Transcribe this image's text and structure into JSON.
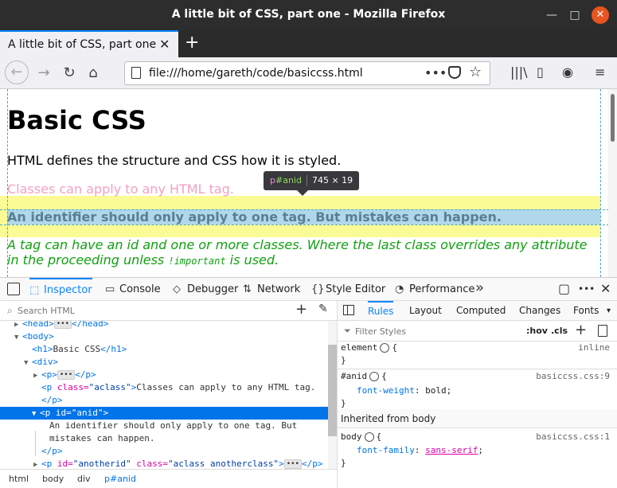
{
  "window": {
    "title": "A little bit of CSS, part one - Mozilla Firefox",
    "min_glyph": "—",
    "max_glyph": "□",
    "close_glyph": "✕"
  },
  "tab": {
    "label": "A little bit of CSS, part one",
    "close_glyph": "✕",
    "new_tab_glyph": "+"
  },
  "nav": {
    "back_glyph": "←",
    "forward_glyph": "→",
    "reload_glyph": "↻",
    "home_glyph": "⌂",
    "url": "file:///home/gareth/code/basiccss.html",
    "more_glyph": "•••",
    "star_glyph": "☆",
    "library_glyph": "|||\\",
    "sidebar_glyph": "▯",
    "account_glyph": "◉",
    "menu_glyph": "≡"
  },
  "page": {
    "h1": "Basic CSS",
    "p1": "HTML defines the structure and CSS how it is styled.",
    "p2": "Classes can apply to any HTML tag.",
    "p3": "An identifier should only apply to one tag. But mistakes can happen.",
    "p4_before": "A tag can have an id and one or more classes. Where the last class overrides any attribute in the proceeding unless ",
    "p4_code": "!important",
    "p4_after": " is used."
  },
  "highlighter_tooltip": {
    "tag": "p",
    "id": "#anid",
    "dimensions": "745 × 19"
  },
  "devtools": {
    "tabs": [
      {
        "label": "Inspector",
        "icon": "inspector-icon",
        "glyph": "⬚"
      },
      {
        "label": "Console",
        "icon": "console-icon",
        "glyph": "▭"
      },
      {
        "label": "Debugger",
        "icon": "debugger-icon",
        "glyph": "◇"
      },
      {
        "label": "Network",
        "icon": "network-icon",
        "glyph": "⇅"
      },
      {
        "label": "Style Editor",
        "icon": "style-editor-icon",
        "glyph": "{}"
      },
      {
        "label": "Performance",
        "icon": "performance-icon",
        "glyph": "◔"
      }
    ],
    "overflow_glyph": "»",
    "dock_glyph": "▢",
    "options_glyph": "•••",
    "close_glyph": "✕",
    "search_placeholder": "Search HTML",
    "add_glyph": "+",
    "eyedropper_glyph": "✎",
    "markup": {
      "ellipsis": "•••",
      "head_open": "<head>",
      "head_close": "</head>",
      "body_open": "<body>",
      "h1_open": "<h1>",
      "h1_text": "Basic CSS",
      "h1_close": "</h1>",
      "div_open": "<div>",
      "p_open": "<p>",
      "p_close": "</p>",
      "p_tag_open": "<p ",
      "gt": ">",
      "class_attr": "class=",
      "aclass_val": "\"aclass\"",
      "classes_text": "Classes can apply to any HTML tag.",
      "id_attr": "id=",
      "anid_val": "\"anid\"",
      "anid_text_1": "An identifier should only apply to one tag. But",
      "anid_text_2": "mistakes can happen.",
      "anotherid_val": "\"anotherid\"",
      "aclass_another_val": "\"aclass anotherclass\""
    },
    "breadcrumbs": [
      "html",
      "body",
      "div",
      "p#anid"
    ],
    "rule_tabs": [
      "Rules",
      "Layout",
      "Computed",
      "Changes",
      "Fonts"
    ],
    "rule_tabs_more_glyph": "▾",
    "filter_placeholder": "Filter Styles",
    "hov_label": ":hov",
    "cls_label": ".cls",
    "rules": {
      "element_selector": "element",
      "element_source": "inline",
      "open_brace": "{",
      "close_brace": "}",
      "anid_selector": "#anid",
      "anid_source": "basiccss.css:9",
      "anid_prop": "font-weight",
      "anid_value": "bold",
      "inherited_header": "Inherited from body",
      "body_selector": "body",
      "body_source": "basiccss.css:1",
      "body_prop": "font-family",
      "body_value": "sans-serif"
    }
  }
}
